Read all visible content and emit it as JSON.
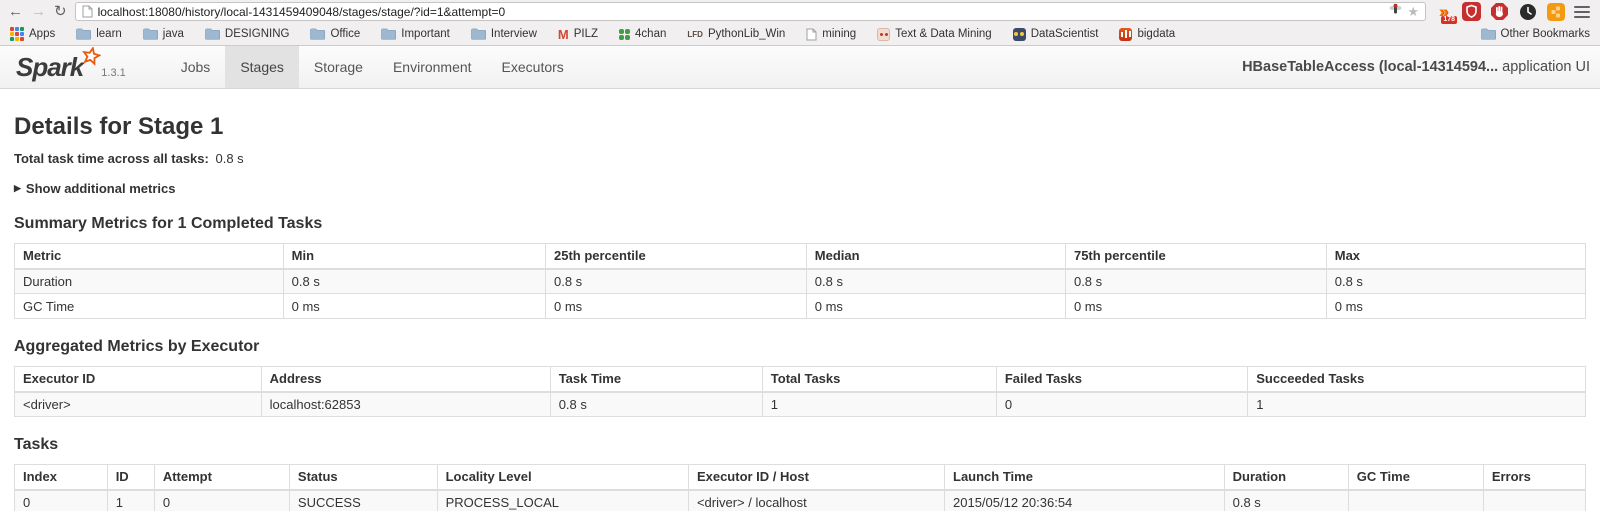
{
  "browser": {
    "url": "localhost:18080/history/local-1431459409048/stages/stage/?id=1&attempt=0",
    "extension_badge": "178",
    "bookmarks": {
      "apps_label": "Apps",
      "items": [
        {
          "label": "learn",
          "icon": "folder"
        },
        {
          "label": "java",
          "icon": "folder"
        },
        {
          "label": "DESIGNING",
          "icon": "folder"
        },
        {
          "label": "Office",
          "icon": "folder"
        },
        {
          "label": "Important",
          "icon": "folder"
        },
        {
          "label": "Interview",
          "icon": "folder"
        },
        {
          "label": "PILZ",
          "icon": "gmail"
        },
        {
          "label": "4chan",
          "icon": "clover"
        },
        {
          "label": "PythonLib_Win",
          "icon": "lfd"
        },
        {
          "label": "mining",
          "icon": "page"
        },
        {
          "label": "Text & Data Mining",
          "icon": "reddit"
        },
        {
          "label": "DataScientist",
          "icon": "binoculars"
        },
        {
          "label": "bigdata",
          "icon": "bigdata"
        }
      ],
      "other_bookmarks_label": "Other Bookmarks"
    }
  },
  "header": {
    "logo": "Spark",
    "version": "1.3.1",
    "nav": [
      {
        "label": "Jobs",
        "active": false
      },
      {
        "label": "Stages",
        "active": true
      },
      {
        "label": "Storage",
        "active": false
      },
      {
        "label": "Environment",
        "active": false
      },
      {
        "label": "Executors",
        "active": false
      }
    ],
    "app_name": "HBaseTableAccess (local-14314594...",
    "app_suffix": "application UI"
  },
  "page": {
    "title": "Details for Stage 1",
    "total_task_time_label": "Total task time across all tasks:",
    "total_task_time_value": "0.8 s",
    "show_metrics_label": "Show additional metrics",
    "summary": {
      "heading": "Summary Metrics for 1 Completed Tasks",
      "columns": [
        "Metric",
        "Min",
        "25th percentile",
        "Median",
        "75th percentile",
        "Max"
      ],
      "rows": [
        [
          "Duration",
          "0.8 s",
          "0.8 s",
          "0.8 s",
          "0.8 s",
          "0.8 s"
        ],
        [
          "GC Time",
          "0 ms",
          "0 ms",
          "0 ms",
          "0 ms",
          "0 ms"
        ]
      ]
    },
    "aggregated": {
      "heading": "Aggregated Metrics by Executor",
      "columns": [
        "Executor ID",
        "Address",
        "Task Time",
        "Total Tasks",
        "Failed Tasks",
        "Succeeded Tasks"
      ],
      "rows": [
        [
          "<driver>",
          "localhost:62853",
          "0.8 s",
          "1",
          "0",
          "1"
        ]
      ]
    },
    "tasks": {
      "heading": "Tasks",
      "columns": [
        "Index",
        "ID",
        "Attempt",
        "Status",
        "Locality Level",
        "Executor ID / Host",
        "Launch Time",
        "Duration",
        "GC Time",
        "Errors"
      ],
      "rows": [
        [
          "0",
          "1",
          "0",
          "SUCCESS",
          "PROCESS_LOCAL",
          "<driver> / localhost",
          "2015/05/12 20:36:54",
          "0.8 s",
          "",
          ""
        ]
      ]
    }
  }
}
